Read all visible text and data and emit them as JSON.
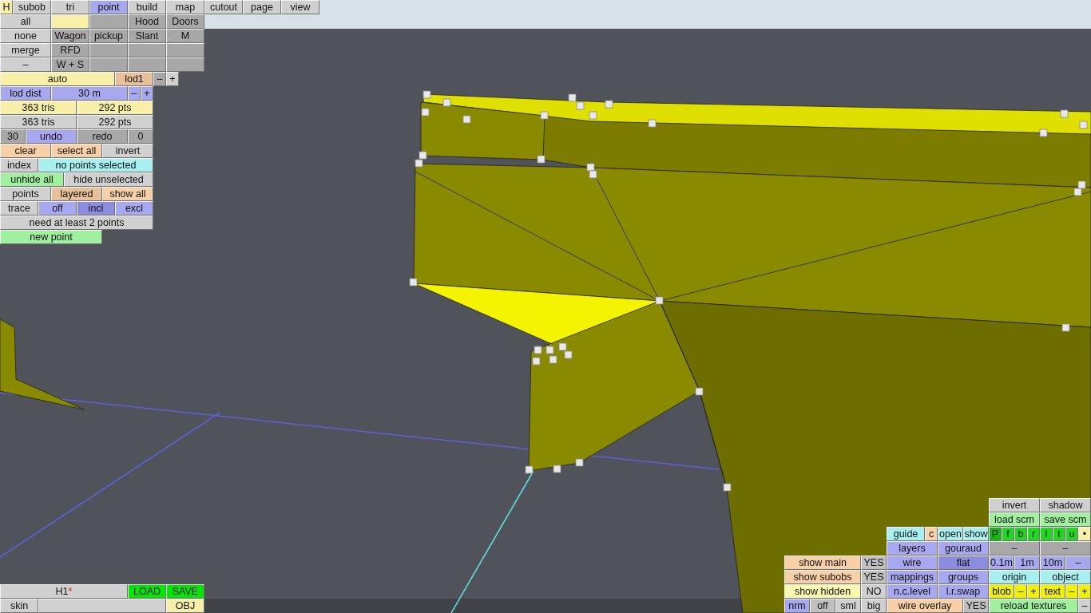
{
  "top_panel": {
    "rows": [
      {
        "buttons": [
          {
            "label": "H",
            "color": "#f8f0a8"
          },
          {
            "label": "subob",
            "color": "#d0d0d0"
          },
          {
            "label": "tri",
            "color": "#d0d0d0"
          },
          {
            "label": "point",
            "color": "#a8a8f0"
          },
          {
            "label": "build",
            "color": "#d0d0d0"
          },
          {
            "label": "map",
            "color": "#d0d0d0"
          },
          {
            "label": "cutout",
            "color": "#d0d0d0"
          },
          {
            "label": "page",
            "color": "#d0d0d0"
          },
          {
            "label": "view",
            "color": "#d0d0d0"
          }
        ]
      },
      {
        "buttons": [
          {
            "label": "all",
            "color": "#d0d0d0"
          },
          {
            "color": "#f8f0a8"
          },
          {
            "color": "#a8a8a8"
          },
          {
            "label": "Hood",
            "color": "#a8a8a8"
          },
          {
            "label": "Doors",
            "color": "#a8a8a8"
          }
        ]
      },
      {
        "buttons": [
          {
            "label": "none",
            "color": "#d0d0d0"
          },
          {
            "label": "Wagon",
            "color": "#a8a8a8"
          },
          {
            "label": "pickup",
            "color": "#a8a8a8"
          },
          {
            "label": "Slant",
            "color": "#a8a8a8"
          },
          {
            "label": "M",
            "color": "#a8a8a8"
          }
        ]
      },
      {
        "buttons": [
          {
            "label": "merge",
            "color": "#d0d0d0"
          },
          {
            "label": "RFD",
            "color": "#a8a8a8"
          },
          {
            "color": "#a8a8a8"
          },
          {
            "color": "#a8a8a8"
          },
          {
            "color": "#a8a8a8"
          }
        ]
      },
      {
        "buttons": [
          {
            "label": "–",
            "color": "#d0d0d0"
          },
          {
            "label": "W + S",
            "color": "#a8a8a8"
          },
          {
            "color": "#a8a8a8"
          },
          {
            "color": "#a8a8a8"
          },
          {
            "color": "#a8a8a8"
          }
        ]
      },
      {
        "buttons": [
          {
            "label": "auto",
            "color": "#f8f0a8"
          },
          {
            "label": "lod1",
            "color": "#e8c09a"
          },
          {
            "label": "–",
            "color": "#a8a8a8"
          },
          {
            "label": "+",
            "color": "#d0d0d0"
          }
        ]
      },
      {
        "buttons": [
          {
            "label": "lod dist",
            "color": "#a8a8f0"
          },
          {
            "label": "30 m",
            "color": "#a8a8f0"
          },
          {
            "label": "–",
            "color": "#a8a8f0"
          },
          {
            "label": "+",
            "color": "#a8a8f0"
          }
        ]
      },
      {
        "buttons": [
          {
            "label": "363 tris",
            "color": "#f8f0a8"
          },
          {
            "label": "292 pts",
            "color": "#f8f0a8"
          }
        ]
      },
      {
        "buttons": [
          {
            "label": "363 tris",
            "color": "#d0d0d0"
          },
          {
            "label": "292 pts",
            "color": "#d0d0d0"
          }
        ]
      },
      {
        "buttons": [
          {
            "label": "30",
            "color": "#a8a8a8"
          },
          {
            "label": "undo",
            "color": "#a8a8f0"
          },
          {
            "label": "redo",
            "color": "#a8a8a8"
          },
          {
            "label": "0",
            "color": "#a8a8a8"
          }
        ]
      },
      {
        "buttons": [
          {
            "label": "clear",
            "color": "#f8d0a8"
          },
          {
            "label": "select all",
            "color": "#f8d0a8"
          },
          {
            "label": "invert",
            "color": "#d0d0d0"
          }
        ]
      },
      {
        "buttons": [
          {
            "label": "index",
            "color": "#d0d0d0"
          },
          {
            "label": "no points selected",
            "color": "#a8f0f0"
          }
        ]
      },
      {
        "buttons": [
          {
            "label": "unhide all",
            "color": "#a0f0a0"
          },
          {
            "label": "hide unselected",
            "color": "#d0d0d0"
          }
        ]
      },
      {
        "buttons": [
          {
            "label": "points",
            "color": "#d0d0d0"
          },
          {
            "label": "layered",
            "color": "#e8c09a"
          },
          {
            "label": "show all",
            "color": "#f8d0a8"
          }
        ]
      },
      {
        "buttons": [
          {
            "label": "trace",
            "color": "#d0d0d0"
          },
          {
            "label": "off",
            "color": "#a8a8f0"
          },
          {
            "label": "incl",
            "color": "#8c8ce0"
          },
          {
            "label": "excl",
            "color": "#a8a8f0"
          }
        ]
      },
      {
        "buttons": [
          {
            "label": "need at least 2 points",
            "color": "#d0d0d0"
          }
        ]
      },
      {
        "buttons": [
          {
            "label": "new point",
            "color": "#a0f0a0"
          }
        ]
      }
    ]
  },
  "file_panel": {
    "rows": [
      {
        "buttons": [
          {
            "label": "H1",
            "flag": "*",
            "color": "#d0d0d0"
          },
          {
            "label": "LOAD",
            "color": "#00e800"
          },
          {
            "label": "SAVE",
            "color": "#00e800"
          }
        ]
      },
      {
        "buttons": [
          {
            "label": "skin",
            "color": "#d0d0d0"
          },
          {
            "color": "#d0d0d0"
          },
          {
            "label": "OBJ",
            "color": "#f8f0a8"
          }
        ]
      }
    ]
  },
  "view_panel": {
    "rows": [
      {
        "buttons": [
          {
            "label": "invert",
            "color": "#d0d0d0"
          },
          {
            "label": "shadow",
            "color": "#d0d0d0"
          }
        ]
      },
      {
        "buttons": [
          {
            "label": "load scm",
            "color": "#a0f0a0"
          },
          {
            "label": "save scm",
            "color": "#a0f0a0"
          }
        ]
      },
      {
        "buttons": [
          {
            "label": "guide",
            "color": "#a8f0f0"
          },
          {
            "label": "c",
            "color": "#f8d0a8"
          },
          {
            "label": "open",
            "color": "#a8f0f0"
          },
          {
            "label": "show",
            "color": "#a8f0f0"
          },
          {
            "label": "P",
            "color": "#10b810"
          },
          {
            "label": "f",
            "color": "#20d820"
          },
          {
            "label": "b",
            "color": "#20d820"
          },
          {
            "label": "r",
            "color": "#20d820"
          },
          {
            "label": "l",
            "color": "#20d820"
          },
          {
            "label": "t",
            "color": "#20d820"
          },
          {
            "label": "u",
            "color": "#20d820"
          },
          {
            "label": "•",
            "color": "#f8f0a8"
          }
        ]
      },
      {
        "buttons": [
          {
            "label": "layers",
            "color": "#a8a8f0"
          },
          {
            "label": "gouraud",
            "color": "#a8a8f0"
          },
          {
            "label": "–",
            "color": "#a8a8a8"
          },
          {
            "label": "–",
            "color": "#a8a8a8"
          }
        ]
      },
      {
        "buttons": [
          {
            "label": "show main",
            "color": "#f8d0a8"
          },
          {
            "label": "YES",
            "color": "#c0c0c0"
          },
          {
            "label": "wire",
            "color": "#a8a8f0"
          },
          {
            "label": "flat",
            "color": "#8c8ce0"
          },
          {
            "label": "0.1m",
            "color": "#a8a8f0"
          },
          {
            "label": "1m",
            "color": "#a8a8f0"
          },
          {
            "label": "10m",
            "color": "#a8a8f0"
          },
          {
            "label": "–",
            "color": "#a8a8f0"
          }
        ]
      },
      {
        "buttons": [
          {
            "label": "show subobs",
            "color": "#f8d0a8"
          },
          {
            "label": "YES",
            "color": "#c0c0c0"
          },
          {
            "label": "mappings",
            "color": "#a8a8f0"
          },
          {
            "label": "groups",
            "color": "#a8a8f0"
          },
          {
            "label": "origin",
            "color": "#a8f0f0"
          },
          {
            "label": "object",
            "color": "#a8f0f0"
          }
        ]
      },
      {
        "buttons": [
          {
            "label": "show hidden",
            "color": "#f8f8b0"
          },
          {
            "label": "NO",
            "color": "#d0d0d0"
          },
          {
            "label": "n.c.level",
            "color": "#a8a8f0"
          },
          {
            "label": "l.r.swap",
            "color": "#a8a8f0"
          },
          {
            "label": "blob",
            "color": "#f0f000"
          },
          {
            "label": "–",
            "color": "#f0f000"
          },
          {
            "label": "+",
            "color": "#f0f000"
          },
          {
            "label": "text",
            "color": "#f0f000"
          },
          {
            "label": "–",
            "color": "#f0f000"
          },
          {
            "label": "+",
            "color": "#f0f000"
          }
        ]
      },
      {
        "buttons": [
          {
            "label": "nrm",
            "color": "#a8a8f0"
          },
          {
            "label": "off",
            "color": "#c0c0c0"
          },
          {
            "label": "sml",
            "color": "#d0d0d0"
          },
          {
            "label": "big",
            "color": "#d0d0d0"
          },
          {
            "label": "wire overlay",
            "color": "#f8d0a8"
          },
          {
            "label": "YES",
            "color": "#c0c0c0"
          },
          {
            "label": "reload textures",
            "color": "#a0f0a0"
          },
          {
            "label": "–",
            "color": "#d0d0d0"
          }
        ]
      }
    ]
  }
}
